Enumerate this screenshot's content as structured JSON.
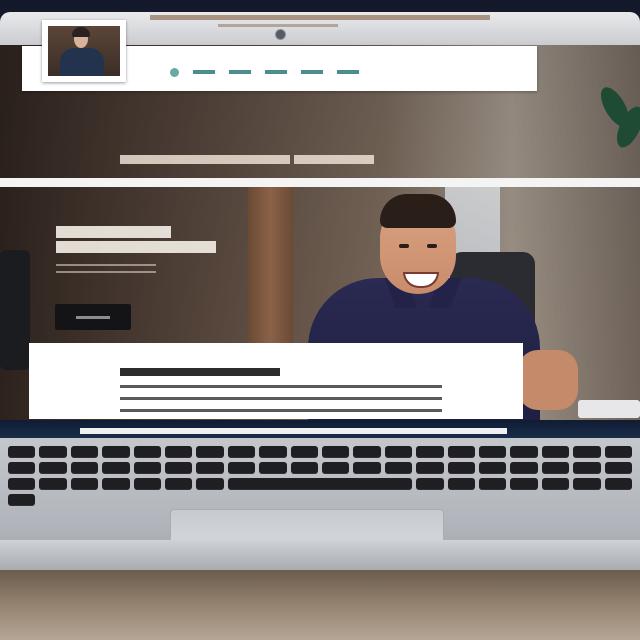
{
  "scene": {
    "kind": "photo-of-laptop-displaying-website"
  },
  "website": {
    "header": {
      "nav_items": [
        "",
        "",
        "",
        "",
        ""
      ],
      "accent_color": "#4c8e90"
    },
    "hero": {
      "button_label": ""
    },
    "icons": [
      "webcam-icon",
      "nav-bullet-icon"
    ]
  },
  "colors": {
    "nav_accent": "#4c8e90",
    "cta_background": "#141416",
    "shirt": "#2a2a52"
  }
}
